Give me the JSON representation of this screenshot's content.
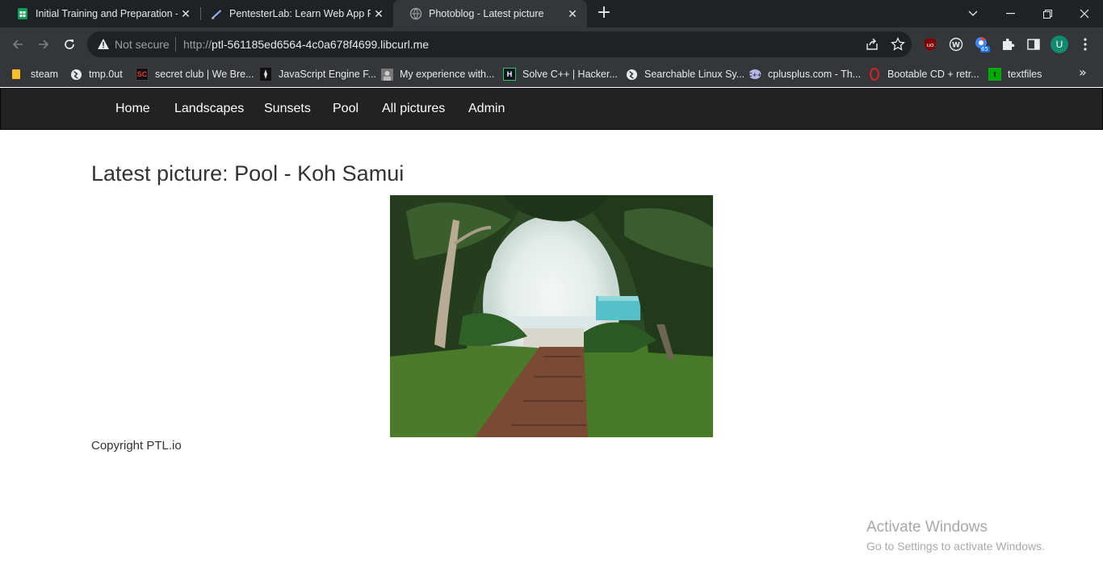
{
  "browser": {
    "tabs": [
      {
        "title": "Initial Training and Preparation -",
        "favicon": "sheets-icon",
        "active": false
      },
      {
        "title": "PentesterLab: Learn Web App Pe",
        "favicon": "pentesterlab-icon",
        "active": false
      },
      {
        "title": "Photoblog - Latest picture",
        "favicon": "globe-icon",
        "active": true
      }
    ],
    "address": {
      "security_label": "Not secure",
      "url_scheme": "http://",
      "url_host": "ptl-561185ed6564-4c0a678f4699.libcurl.me"
    },
    "profile_initial": "U",
    "extension_badge": "65",
    "bookmarks": [
      {
        "label": "steam",
        "icon": "folder-icon"
      },
      {
        "label": "tmp.0ut",
        "icon": "globe-icon"
      },
      {
        "label": "secret club | We Bre...",
        "icon": "secretclub-icon"
      },
      {
        "label": "JavaScript Engine F...",
        "icon": "bookmark-site-icon"
      },
      {
        "label": "My experience with...",
        "icon": "bookmark-site-icon"
      },
      {
        "label": "Solve C++ | Hacker...",
        "icon": "hackerrank-icon"
      },
      {
        "label": "Searchable Linux Sy...",
        "icon": "globe-icon"
      },
      {
        "label": "cplusplus.com - Th...",
        "icon": "cplusplus-icon"
      },
      {
        "label": "Bootable CD + retr...",
        "icon": "opera-icon"
      },
      {
        "label": "textfiles",
        "icon": "textfiles-icon"
      }
    ]
  },
  "page": {
    "nav": [
      "Home",
      "Landscapes",
      "Sunsets",
      "Pool",
      "All pictures",
      "Admin"
    ],
    "heading": "Latest picture: Pool - Koh Samui",
    "copyright": "Copyright PTL.io"
  },
  "watermark": {
    "line1": "Activate Windows",
    "line2": "Go to Settings to activate Windows."
  },
  "colors": {
    "tabstrip": "#202124",
    "toolbar": "#35363a",
    "sitenav": "#222222",
    "text": "#333333"
  }
}
